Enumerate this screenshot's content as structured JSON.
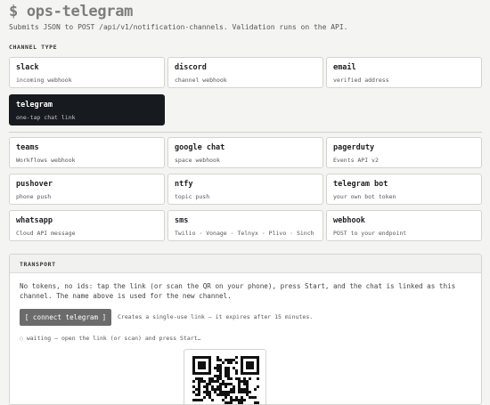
{
  "header": {
    "title": "$ ops-telegram",
    "subtitle": "Submits JSON to POST /api/v1/notification-channels. Validation runs on the API."
  },
  "channel_type": {
    "label": "CHANNEL TYPE",
    "selected": "telegram",
    "primary": [
      {
        "id": "slack",
        "name": "slack",
        "desc": "incoming webhook"
      },
      {
        "id": "discord",
        "name": "discord",
        "desc": "channel webhook"
      },
      {
        "id": "email",
        "name": "email",
        "desc": "verified address"
      },
      {
        "id": "telegram",
        "name": "telegram",
        "desc": "one-tap chat link"
      }
    ],
    "more": [
      {
        "id": "teams",
        "name": "teams",
        "desc": "Workflows webhook"
      },
      {
        "id": "google-chat",
        "name": "google chat",
        "desc": "space webhook"
      },
      {
        "id": "pagerduty",
        "name": "pagerduty",
        "desc": "Events API v2"
      },
      {
        "id": "pushover",
        "name": "pushover",
        "desc": "phone push"
      },
      {
        "id": "ntfy",
        "name": "ntfy",
        "desc": "topic push"
      },
      {
        "id": "telegram-bot",
        "name": "telegram bot",
        "desc": "your own bot token"
      },
      {
        "id": "whatsapp",
        "name": "whatsapp",
        "desc": "Cloud API message"
      },
      {
        "id": "sms",
        "name": "sms",
        "desc": "Twilio · Vonage · Telnyx · Plivo · Sinch"
      },
      {
        "id": "webhook",
        "name": "webhook",
        "desc": "POST to your endpoint"
      }
    ]
  },
  "transport": {
    "label": "TRANSPORT",
    "description": "No tokens, no ids: tap the link (or scan the QR on your phone), press Start, and the chat is linked as this channel. The name above is used for the new channel.",
    "connect_label": "[ connect telegram ]",
    "connect_hint": "Creates a single-use link — it expires after 15 minutes.",
    "status": "◌ waiting — open the link (or scan) and press Start…"
  },
  "colors": {
    "selected_card_bg": "#171a1e",
    "connect_button_bg": "#6b6b6b",
    "page_bg": "#f4f4f3"
  }
}
